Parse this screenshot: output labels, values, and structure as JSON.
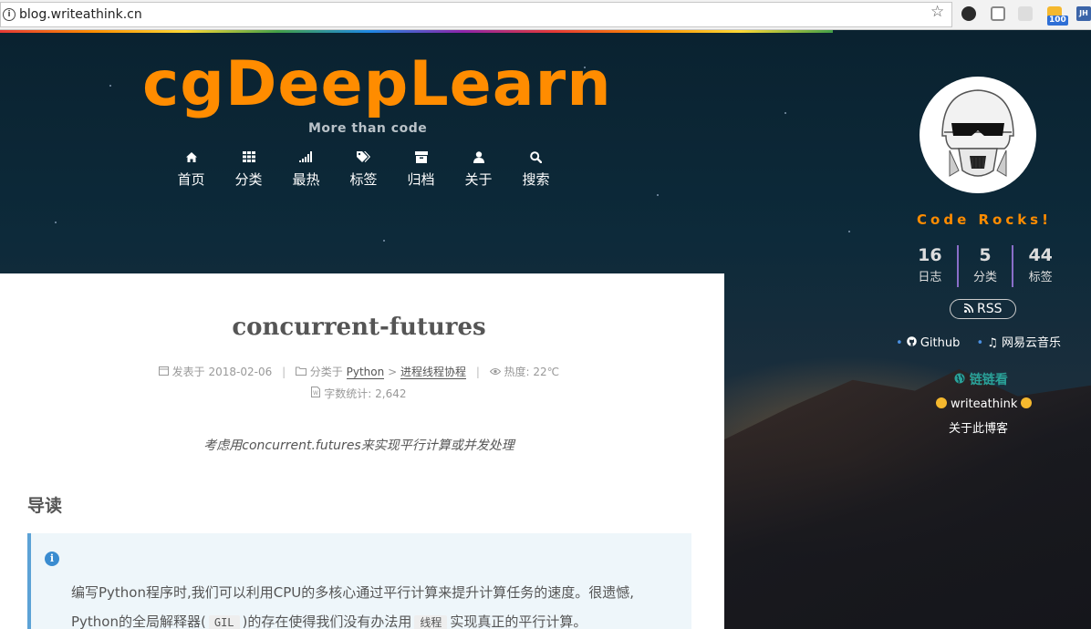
{
  "browser": {
    "url": "blog.writeathink.cn",
    "extension_badge": "100",
    "extension_initials": "JH"
  },
  "header": {
    "title": "cgDeepLearn",
    "subtitle": "More than code",
    "nav": [
      {
        "label": "首页",
        "icon": "home-icon"
      },
      {
        "label": "分类",
        "icon": "grid-icon"
      },
      {
        "label": "最热",
        "icon": "signal-icon"
      },
      {
        "label": "标签",
        "icon": "tags-icon"
      },
      {
        "label": "归档",
        "icon": "archive-icon"
      },
      {
        "label": "关于",
        "icon": "user-icon"
      },
      {
        "label": "搜索",
        "icon": "search-icon"
      }
    ]
  },
  "post": {
    "title": "concurrent-futures",
    "published_label": "发表于",
    "published_date": "2018-02-06",
    "category_label": "分类于",
    "category_parent": "Python",
    "category_child": "进程线程协程",
    "heat_label": "热度:",
    "heat_value": "22℃",
    "wordcount_label": "字数统计:",
    "wordcount_value": "2,642",
    "description": "考虑用concurrent.futures来实现平行计算或并发处理",
    "section_heading": "导读",
    "note_line1": "编写Python程序时,我们可以利用CPU的多核心通过平行计算来提升计算任务的速度。很遗憾,",
    "note_line2_a": "Python的全局解释器(",
    "note_code1": "GIL",
    "note_line2_b": ")的存在使得我们没有办法用",
    "note_code2": "线程",
    "note_line2_c": "实现真正的平行计算。"
  },
  "sidebar": {
    "motto": "Code Rocks!",
    "stats": [
      {
        "num": "16",
        "label": "日志"
      },
      {
        "num": "5",
        "label": "分类"
      },
      {
        "num": "44",
        "label": "标签"
      }
    ],
    "rss": "RSS",
    "links": [
      {
        "label": "Github",
        "icon": "github-icon"
      },
      {
        "label": "网易云音乐",
        "icon": "music-icon"
      }
    ],
    "blogroll_title": "链链看",
    "friend": "writeathink",
    "about": "关于此博客"
  }
}
